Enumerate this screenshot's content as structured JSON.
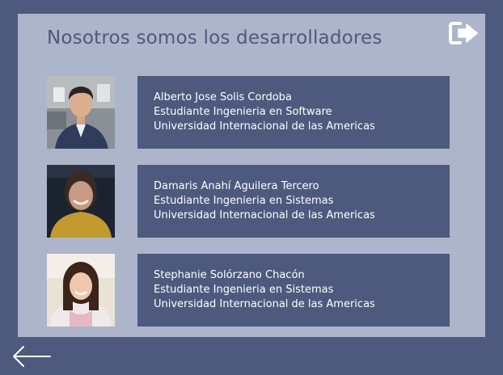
{
  "page": {
    "title": "Nosotros somos los desarrolladores"
  },
  "icons": {
    "logout": "logout-icon",
    "back": "arrow-left-icon"
  },
  "colors": {
    "background": "#4d5a7e",
    "panel": "#adb5ca",
    "card": "#4d5a7e",
    "card_text": "#ffffff",
    "title_text": "#4d5a7e"
  },
  "developers": [
    {
      "name": "Alberto Jose Solis Cordoba",
      "role": "Estudiante Ingenieria en Software",
      "university": "Universidad Internacional de las Americas"
    },
    {
      "name": "Damaris Anahí Aguilera Tercero",
      "role": "Estudiante Ingenieria en Sistemas",
      "university": "Universidad Internacional de las Americas"
    },
    {
      "name": "Stephanie Solórzano Chacón",
      "role": "Estudiante Ingenieria en Sistemas",
      "university": "Universidad Internacional de las Americas"
    }
  ]
}
